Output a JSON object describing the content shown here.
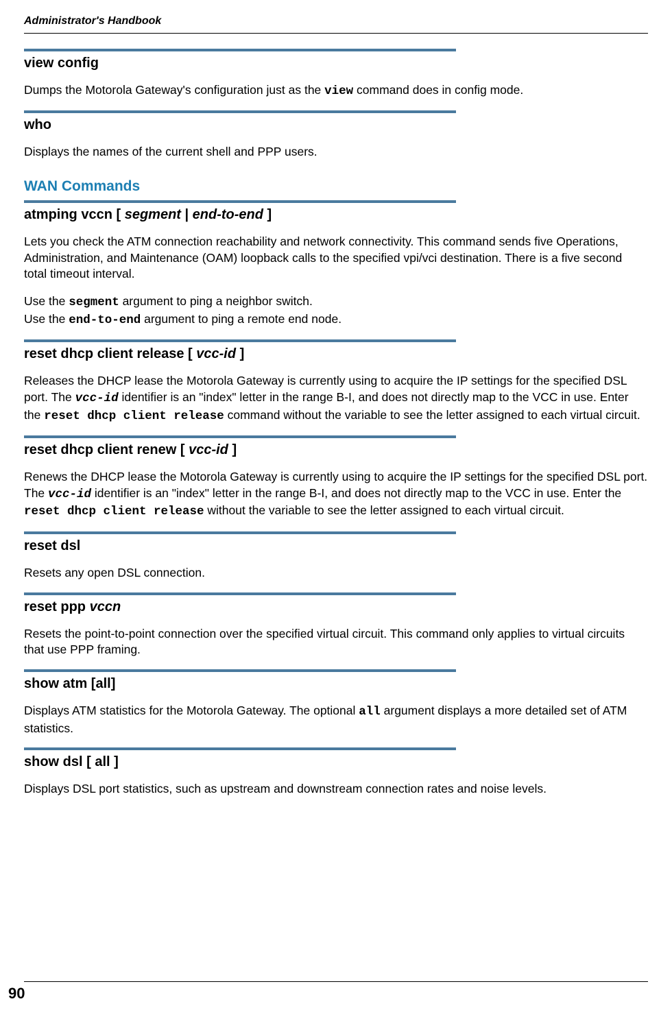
{
  "header": {
    "title": "Administrator's Handbook"
  },
  "sections": [
    {
      "id": "view-config",
      "heading_plain": "view config",
      "body_parts": [
        {
          "t": "text",
          "v": "Dumps the Motorola Gateway's configuration just as the "
        },
        {
          "t": "mono",
          "v": "view"
        },
        {
          "t": "text",
          "v": " command does in config mode."
        }
      ]
    },
    {
      "id": "who",
      "heading_plain": "who",
      "body_parts": [
        {
          "t": "text",
          "v": "Displays the names of the current shell and PPP users."
        }
      ]
    }
  ],
  "wan_title": "WAN Commands",
  "wan_sections": [
    {
      "id": "atmping",
      "heading_parts": [
        {
          "t": "plain",
          "v": "atmping vccn [ "
        },
        {
          "t": "ital",
          "v": "segment"
        },
        {
          "t": "plain",
          "v": " | "
        },
        {
          "t": "ital",
          "v": "end-to-end"
        },
        {
          "t": "plain",
          "v": " ]"
        }
      ],
      "paras": [
        [
          {
            "t": "text",
            "v": "Lets you check the ATM connection reachability and network connectivity. This command sends five Operations, Administration, and Maintenance (OAM) loopback calls to the specified vpi/vci destination. There is a five second total timeout interval."
          }
        ],
        [
          {
            "t": "text",
            "v": "Use the "
          },
          {
            "t": "mono",
            "v": "segment"
          },
          {
            "t": "text",
            "v": " argument to ping a neighbor switch."
          },
          {
            "t": "br"
          },
          {
            "t": "text",
            "v": "Use the "
          },
          {
            "t": "mono",
            "v": "end-to-end"
          },
          {
            "t": "text",
            "v": " argument to ping a remote end node."
          }
        ]
      ]
    },
    {
      "id": "reset-dhcp-release",
      "heading_parts": [
        {
          "t": "plain",
          "v": "reset dhcp client release [ "
        },
        {
          "t": "ital",
          "v": "vcc-id"
        },
        {
          "t": "plain",
          "v": " ]"
        }
      ],
      "paras": [
        [
          {
            "t": "text",
            "v": "Releases the DHCP lease the Motorola Gateway is currently using to acquire the IP settings for the specified DSL port. The "
          },
          {
            "t": "monoit",
            "v": "vcc-id"
          },
          {
            "t": "text",
            "v": " identifier is an \"index\" letter in the range B-I, and does not directly map to the VCC in use. Enter the "
          },
          {
            "t": "mono",
            "v": "reset dhcp client release"
          },
          {
            "t": "text",
            "v": " command without the variable to see the letter assigned to each virtual circuit."
          }
        ]
      ]
    },
    {
      "id": "reset-dhcp-renew",
      "heading_parts": [
        {
          "t": "plain",
          "v": "reset dhcp client renew [ "
        },
        {
          "t": "ital",
          "v": "vcc-id"
        },
        {
          "t": "plain",
          "v": " ]"
        }
      ],
      "paras": [
        [
          {
            "t": "text",
            "v": "Renews the DHCP lease the Motorola Gateway is currently using to acquire the IP settings for the specified DSL port. The "
          },
          {
            "t": "monoit",
            "v": "vcc-id"
          },
          {
            "t": "text",
            "v": " identifier is an \"index\" letter in the range B-I, and does not directly map to the VCC in use. Enter the "
          },
          {
            "t": "mono",
            "v": "reset dhcp client release"
          },
          {
            "t": "text",
            "v": " without the variable to see the letter assigned to each virtual circuit."
          }
        ]
      ]
    },
    {
      "id": "reset-dsl",
      "heading_parts": [
        {
          "t": "plain",
          "v": "reset dsl"
        }
      ],
      "paras": [
        [
          {
            "t": "text",
            "v": "Resets any open DSL connection."
          }
        ]
      ]
    },
    {
      "id": "reset-ppp",
      "heading_parts": [
        {
          "t": "plain",
          "v": "reset ppp "
        },
        {
          "t": "ital",
          "v": "vccn"
        }
      ],
      "paras": [
        [
          {
            "t": "text",
            "v": "Resets the point-to-point connection over the specified virtual circuit. This command only applies to virtual circuits that use PPP framing."
          }
        ]
      ]
    },
    {
      "id": "show-atm",
      "heading_parts": [
        {
          "t": "plain",
          "v": "show atm [all]"
        }
      ],
      "paras": [
        [
          {
            "t": "text",
            "v": "Displays ATM statistics for the Motorola Gateway. The optional "
          },
          {
            "t": "mono",
            "v": "all"
          },
          {
            "t": "text",
            "v": " argument displays a more detailed set of ATM statistics."
          }
        ]
      ]
    },
    {
      "id": "show-dsl",
      "heading_parts": [
        {
          "t": "plain",
          "v": "show dsl [ all ]"
        }
      ],
      "paras": [
        [
          {
            "t": "text",
            "v": "Displays DSL port statistics, such as upstream and downstream connection rates and noise levels."
          }
        ]
      ]
    }
  ],
  "page_number": "90"
}
